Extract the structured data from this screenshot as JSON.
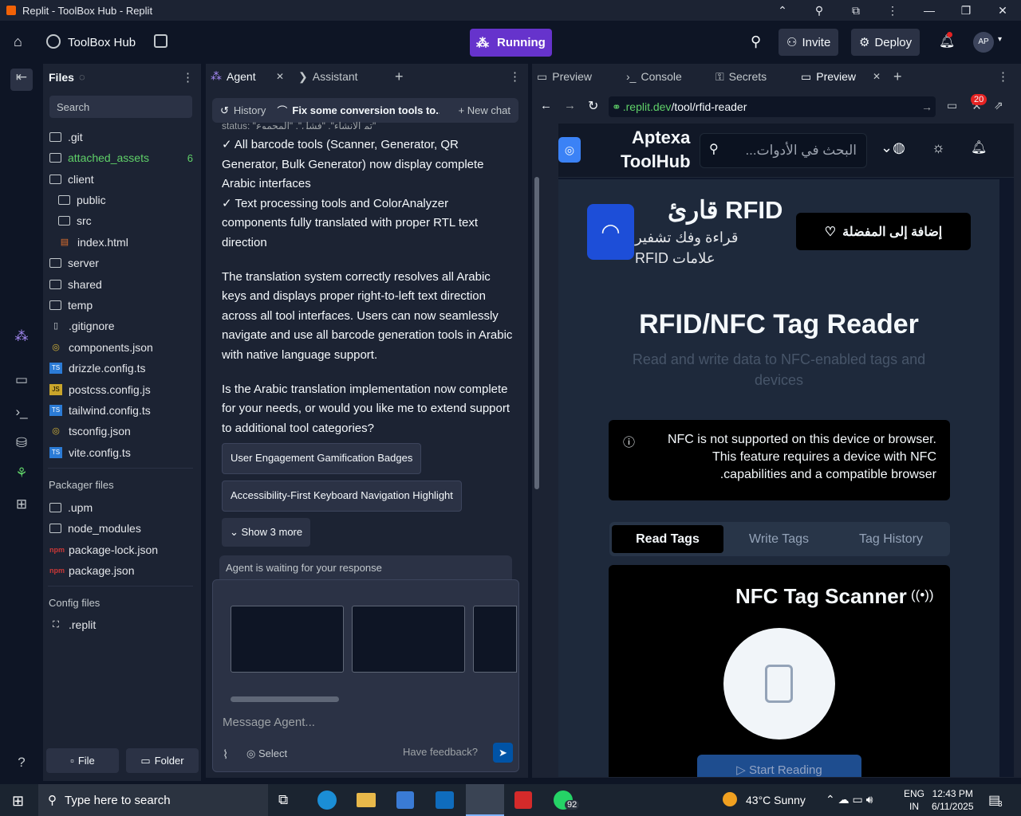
{
  "window": {
    "title": "Replit - ToolBox Hub - Replit"
  },
  "header": {
    "project": "ToolBox Hub",
    "run_label": "Running",
    "invite": "Invite",
    "deploy": "Deploy",
    "avatar": "AP"
  },
  "files": {
    "title": "Files",
    "search_placeholder": "Search",
    "items": [
      {
        "name": ".git"
      },
      {
        "name": "attached_assets",
        "badge": "6"
      },
      {
        "name": "client"
      },
      {
        "name": "public"
      },
      {
        "name": "src"
      },
      {
        "name": "index.html"
      },
      {
        "name": "server"
      },
      {
        "name": "shared"
      },
      {
        "name": "temp"
      },
      {
        "name": ".gitignore"
      },
      {
        "name": "components.json"
      },
      {
        "name": "drizzle.config.ts"
      },
      {
        "name": "postcss.config.js"
      },
      {
        "name": "tailwind.config.ts"
      },
      {
        "name": "tsconfig.json"
      },
      {
        "name": "vite.config.ts"
      }
    ],
    "packager_title": "Packager files",
    "packager": [
      ".upm",
      "node_modules",
      "package-lock.json",
      "package.json"
    ],
    "config_title": "Config files",
    "config": [
      ".replit"
    ],
    "file_btn": "File",
    "folder_btn": "Folder"
  },
  "agent": {
    "tab_agent": "Agent",
    "tab_assistant": "Assistant",
    "history": "History",
    "chat_title": "Fix some conversion tools to...",
    "new_chat": "New chat",
    "partial": "status: \"تم الإنشاء\", \"فشل\", \"المجموع\"",
    "line1": "✓ All barcode tools (Scanner, Generator, QR Generator, Bulk Generator) now display complete Arabic interfaces",
    "line2": "✓ Text processing tools and ColorAnalyzer components fully translated with proper RTL text direction",
    "para1": "The translation system correctly resolves all Arabic keys and displays proper right-to-left text direction across all tool interfaces. Users can now seamlessly navigate and use all barcode generation tools in Arabic with native language support.",
    "para2": "Is the Arabic translation implementation now complete for your needs, or would you like me to extend support to additional tool categories?",
    "chip1": "User Engagement Gamification Badges",
    "chip2": "Accessibility-First Keyboard Navigation Highlight",
    "show_more": "Show 3 more",
    "waiting": "Agent is waiting for your response",
    "input_placeholder": "Message Agent...",
    "select": "Select",
    "feedback": "Have feedback?"
  },
  "preview": {
    "tabs": [
      "Preview",
      "Console",
      "Secrets",
      "Preview"
    ],
    "url_host": ".replit.dev",
    "url_path": "/tool/rfid-reader",
    "badge": "20",
    "site": {
      "brand1": "Aptexa",
      "brand2": "ToolHub",
      "search": "البحث في الأدوات...",
      "tool_title": "قارئ RFID",
      "tool_desc": "قراءة وفك تشفير علامات RFID",
      "fav": "إضافة إلى المفضلة",
      "h1": "RFID/NFC Tag Reader",
      "sub": "Read and write data to NFC-enabled tags and devices",
      "alert": "NFC is not supported on this device or browser. This feature requires a device with NFC .capabilities and a compatible browser",
      "tabs": [
        "Read Tags",
        "Write Tags",
        "Tag History"
      ],
      "scanner": "NFC Tag Scanner",
      "start": "Start Reading"
    }
  },
  "taskbar": {
    "search": "Type here to search",
    "weather": "43°C  Sunny",
    "lang1": "ENG",
    "lang2": "IN",
    "time": "12:43 PM",
    "date": "6/11/2025",
    "wa_badge": "92",
    "notif": "3"
  }
}
